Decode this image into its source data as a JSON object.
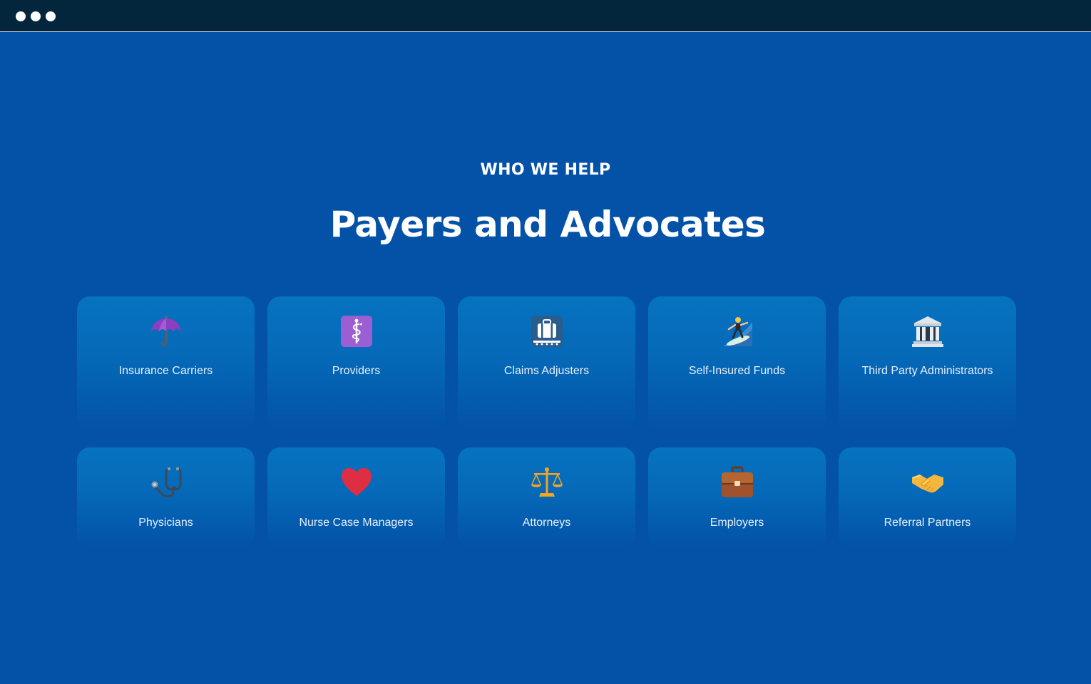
{
  "section": {
    "eyebrow": "WHO WE HELP",
    "title": "Payers and Advocates"
  },
  "cards": [
    {
      "label": "Insurance Carriers",
      "icon": "umbrella-icon"
    },
    {
      "label": "Providers",
      "icon": "medical-symbol-icon"
    },
    {
      "label": "Claims Adjusters",
      "icon": "baggage-claim-icon"
    },
    {
      "label": "Self-Insured Funds",
      "icon": "surfer-icon"
    },
    {
      "label": "Third Party Administrators",
      "icon": "classical-building-icon"
    },
    {
      "label": "Physicians",
      "icon": "stethoscope-icon"
    },
    {
      "label": "Nurse Case Managers",
      "icon": "red-heart-icon"
    },
    {
      "label": "Attorneys",
      "icon": "balance-scale-icon"
    },
    {
      "label": "Employers",
      "icon": "briefcase-icon"
    },
    {
      "label": "Referral Partners",
      "icon": "handshake-icon"
    }
  ],
  "colors": {
    "background": "#0352a8",
    "titlebar": "#03263d",
    "card_top": "#0673c0"
  }
}
